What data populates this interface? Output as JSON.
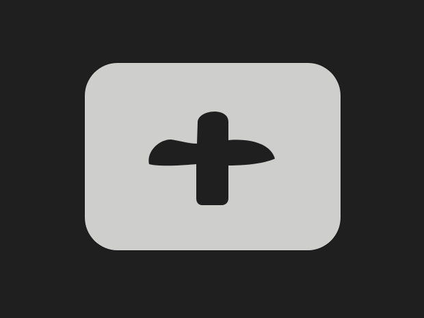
{
  "screen": {
    "background_color": "#1f1f20"
  },
  "add_tile": {
    "icon": "plus-icon",
    "tile_color": "#cececd",
    "icon_color": "#1f1f20"
  }
}
